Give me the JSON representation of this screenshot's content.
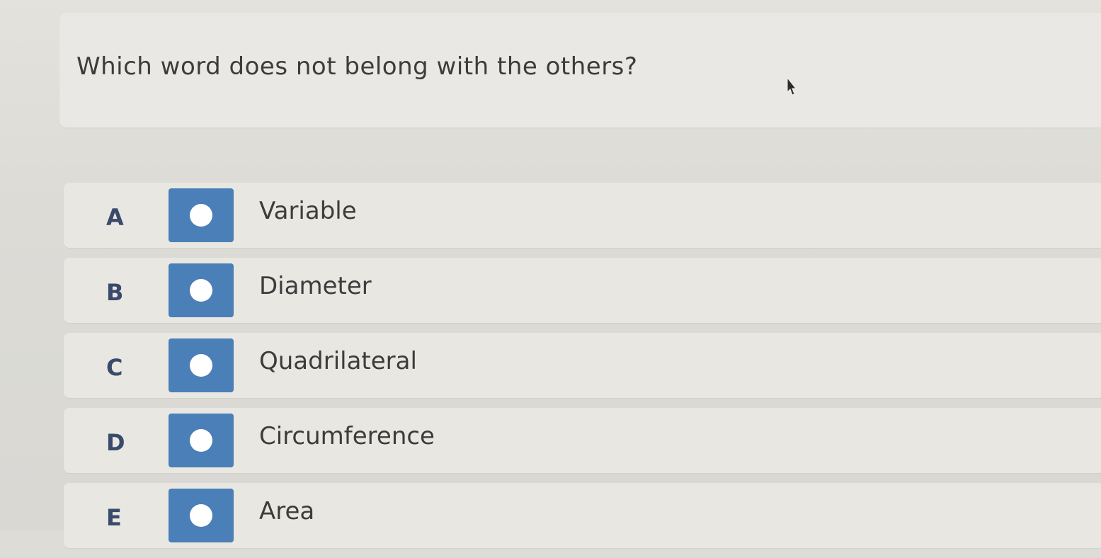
{
  "question": {
    "text": "Which word does not belong with the others?"
  },
  "answers": [
    {
      "letter": "A",
      "label": "Variable",
      "selected": false
    },
    {
      "letter": "B",
      "label": "Diameter",
      "selected": false
    },
    {
      "letter": "C",
      "label": "Quadrilateral",
      "selected": false
    },
    {
      "letter": "D",
      "label": "Circumference",
      "selected": false
    },
    {
      "letter": "E",
      "label": "Area",
      "selected": false
    }
  ],
  "colors": {
    "radio_fill": "#4b7fb8",
    "letter_color": "#3a4a6b",
    "card_bg": "#e9e8e4"
  },
  "icons": {
    "cursor": "mouse-pointer-icon",
    "radio": "radio-circle-icon"
  }
}
